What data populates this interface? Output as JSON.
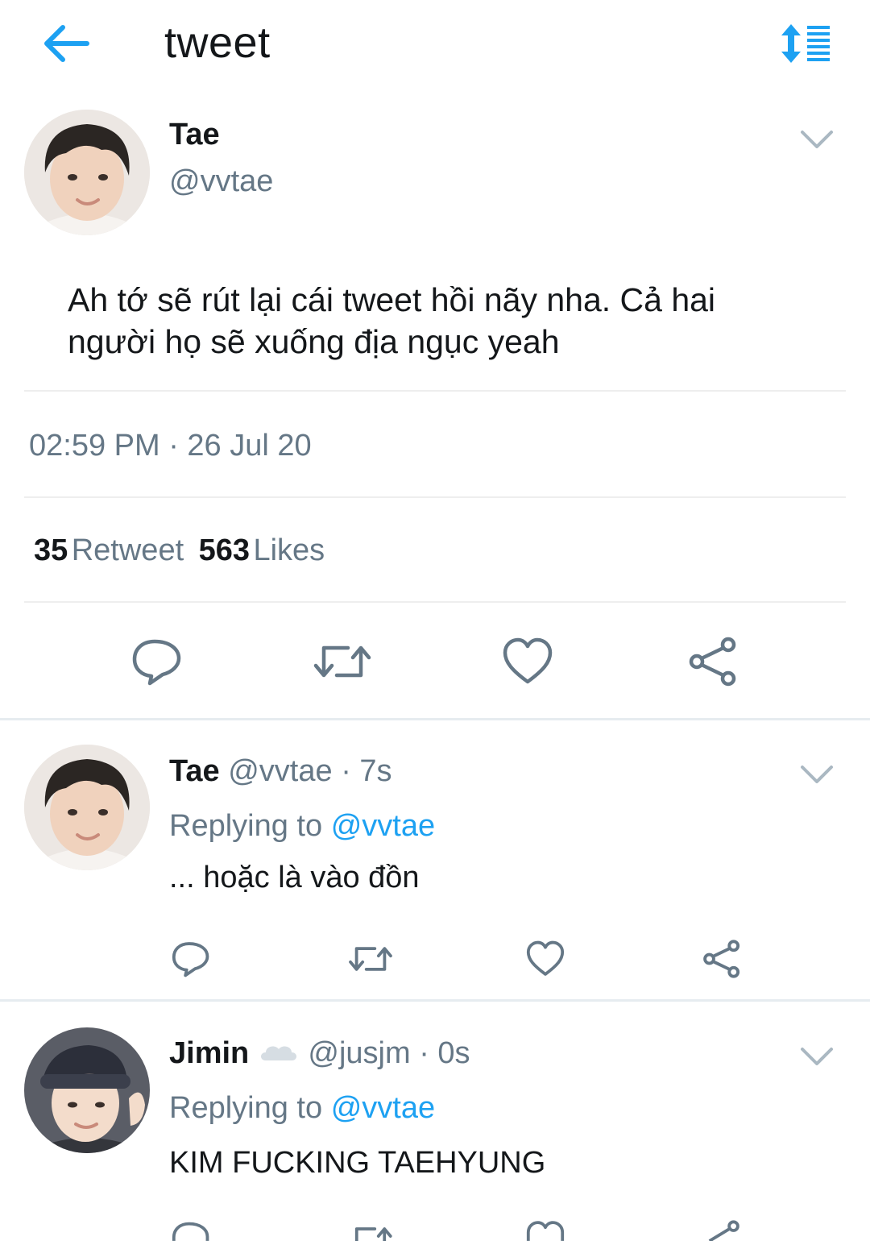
{
  "header": {
    "title": "tweet",
    "accent_color": "#1da1f2",
    "back_icon": "back-arrow-icon",
    "sort_icon": "sort-icon"
  },
  "main_tweet": {
    "name": "Tae",
    "handle": "@vvtae",
    "text_line1": "Ah tớ sẽ rút lại cái tweet hồi nãy nha. Cả hai",
    "text_line2": "người họ sẽ xuống địa ngục yeah",
    "timestamp": "02:59 PM · 26 Jul 20",
    "retweet_count": "35",
    "retweet_label": "Retweet",
    "likes_count": "563",
    "likes_label": "Likes"
  },
  "replies": [
    {
      "name": "Tae",
      "handle": "@vvtae",
      "time": "· 7s",
      "replying_label": "Replying to",
      "replying_to": "@vvtae",
      "text": "... hoặc là vào đồn"
    },
    {
      "name": "Jimin",
      "emoji": "cloud-icon",
      "handle": "@jusjm",
      "time": "· 0s",
      "replying_label": "Replying to",
      "replying_to": "@vvtae",
      "text": "KIM FUCKING TAEHYUNG"
    }
  ],
  "colors": {
    "text": "#14171a",
    "secondary": "#657786",
    "link": "#1da1f2",
    "divider": "#eeeeee"
  }
}
